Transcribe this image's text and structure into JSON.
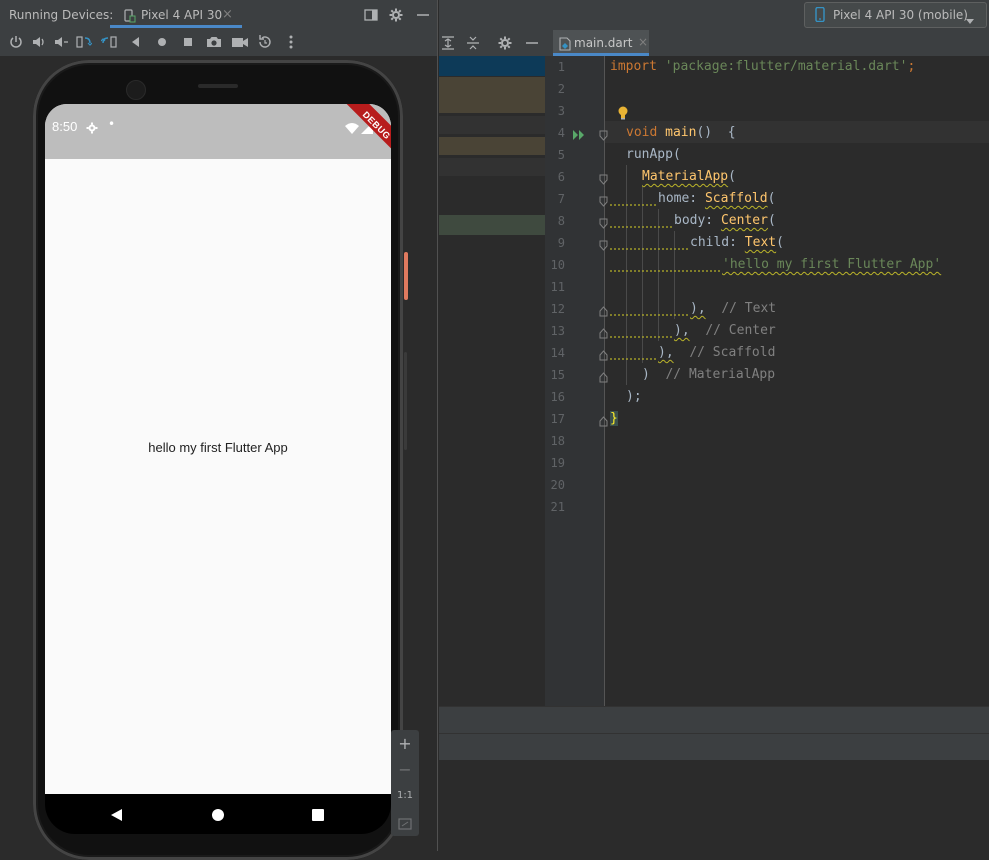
{
  "running_devices": {
    "label": "Running Devices:",
    "tab_label": "Pixel 4 API 30",
    "tab_close": "×"
  },
  "device_selector": {
    "label": "Pixel 4 API 30 (mobile)"
  },
  "editor": {
    "tab_label": "main.dart",
    "tab_close": "×",
    "line_numbers": [
      "1",
      "2",
      "3",
      "4",
      "5",
      "6",
      "7",
      "8",
      "9",
      "10",
      "11",
      "12",
      "13",
      "14",
      "15",
      "16",
      "17",
      "18",
      "19",
      "20",
      "21"
    ],
    "code": {
      "l1_kw": "import",
      "l1_str": "'package:flutter/material.dart'",
      "l1_end": ";",
      "l4_kw": "void",
      "l4_fn": "main",
      "l4_rest": "()  {",
      "l5": "runApp(",
      "l6_cls": "MaterialApp",
      "l6_rest": "(",
      "l7_param": "home: ",
      "l7_cls": "Scaffold",
      "l7_rest": "(",
      "l8_param": "body: ",
      "l8_cls": "Center",
      "l8_rest": "(",
      "l9_param": "child: ",
      "l9_cls": "Text",
      "l9_rest": "(",
      "l10_str": "'hello my first Flutter App'",
      "l12_code": "),",
      "l12_cmt": "// Text",
      "l13_code": "),",
      "l13_cmt": "// Center",
      "l14_code": "),",
      "l14_cmt": "// Scaffold",
      "l15_code": ")",
      "l15_cmt": "// MaterialApp",
      "l16_code": ");",
      "l17_code": "}"
    }
  },
  "phone": {
    "status_time": "8:50",
    "status_dot": "•",
    "debug_banner": "DEBUG",
    "body_text": "hello my first Flutter App"
  },
  "zoom_controls": {
    "zoom_in": "+",
    "zoom_out": "−",
    "actual_size": "1:1"
  },
  "colors": {
    "status_bar": "#bdbdbd",
    "screen_bg": "#fafafa",
    "debug_banner": "#b71c1c",
    "accent": "#3592c4"
  }
}
